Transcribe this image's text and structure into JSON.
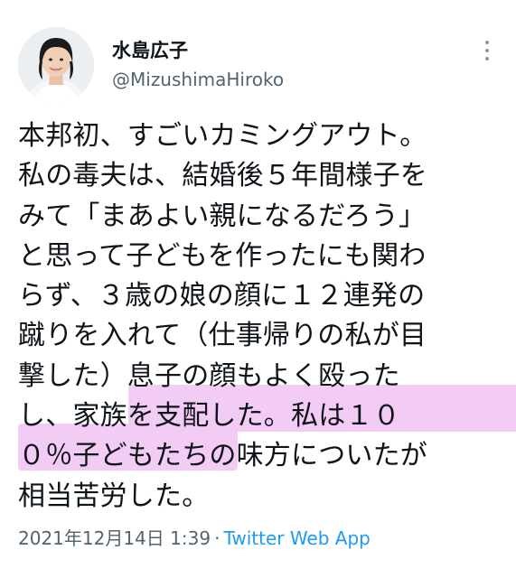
{
  "author": {
    "display_name": "水島広子",
    "handle": "@MizushimaHiroko",
    "avatar_icon": "profile-photo"
  },
  "more_icon": "more-dots-icon",
  "tweet": {
    "lines": [
      "本邦初、すごいカミングアウト。",
      "私の毒夫は、結婚後５年間様子を",
      "みて「まあよい親になるだろう」",
      "と思って子どもを作ったにも関わ",
      "らず、３歳の娘の顔に１２連発の",
      "蹴りを入れて（仕事帰りの私が目",
      "撃した）息子の顔もよく殴った",
      "し、家族を支配した。私は１０",
      "０％子どもたちの味方についたが",
      "相当苦労した。"
    ],
    "highlight_color": "#f3ccf5"
  },
  "footer": {
    "datetime": "2021年12月14日 1:39",
    "separator": "·",
    "source_app": "Twitter Web App"
  },
  "colors": {
    "text": "#0f1419",
    "secondary": "#536471",
    "link": "#1d9bf0"
  }
}
